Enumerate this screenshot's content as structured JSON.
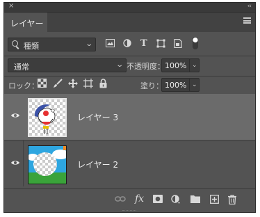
{
  "panel": {
    "title_tab": "レイヤー",
    "close_glyph": "×",
    "collapse_glyph": "‹‹"
  },
  "filter": {
    "kind_value": "種類",
    "icons": [
      "image-filter-icon",
      "adjustment-filter-icon",
      "type-filter-icon",
      "shape-filter-icon",
      "smart-object-filter-icon",
      "filter-toggle-icon"
    ]
  },
  "blend": {
    "mode_value": "通常",
    "opacity_label": "不透明度：",
    "opacity_value": "100%"
  },
  "lock": {
    "label": "ロック：",
    "fill_label": "塗り：",
    "fill_value": "100%"
  },
  "layers": [
    {
      "name": "レイヤー 3",
      "selected": true,
      "visible": true
    },
    {
      "name": "レイヤー 2",
      "selected": false,
      "visible": true
    }
  ],
  "footer": {
    "icons": [
      "link-layers-icon",
      "layer-style-icon",
      "add-mask-icon",
      "new-adjustment-icon",
      "new-group-icon",
      "new-layer-icon",
      "delete-layer-icon"
    ],
    "fx_text": "fx"
  }
}
